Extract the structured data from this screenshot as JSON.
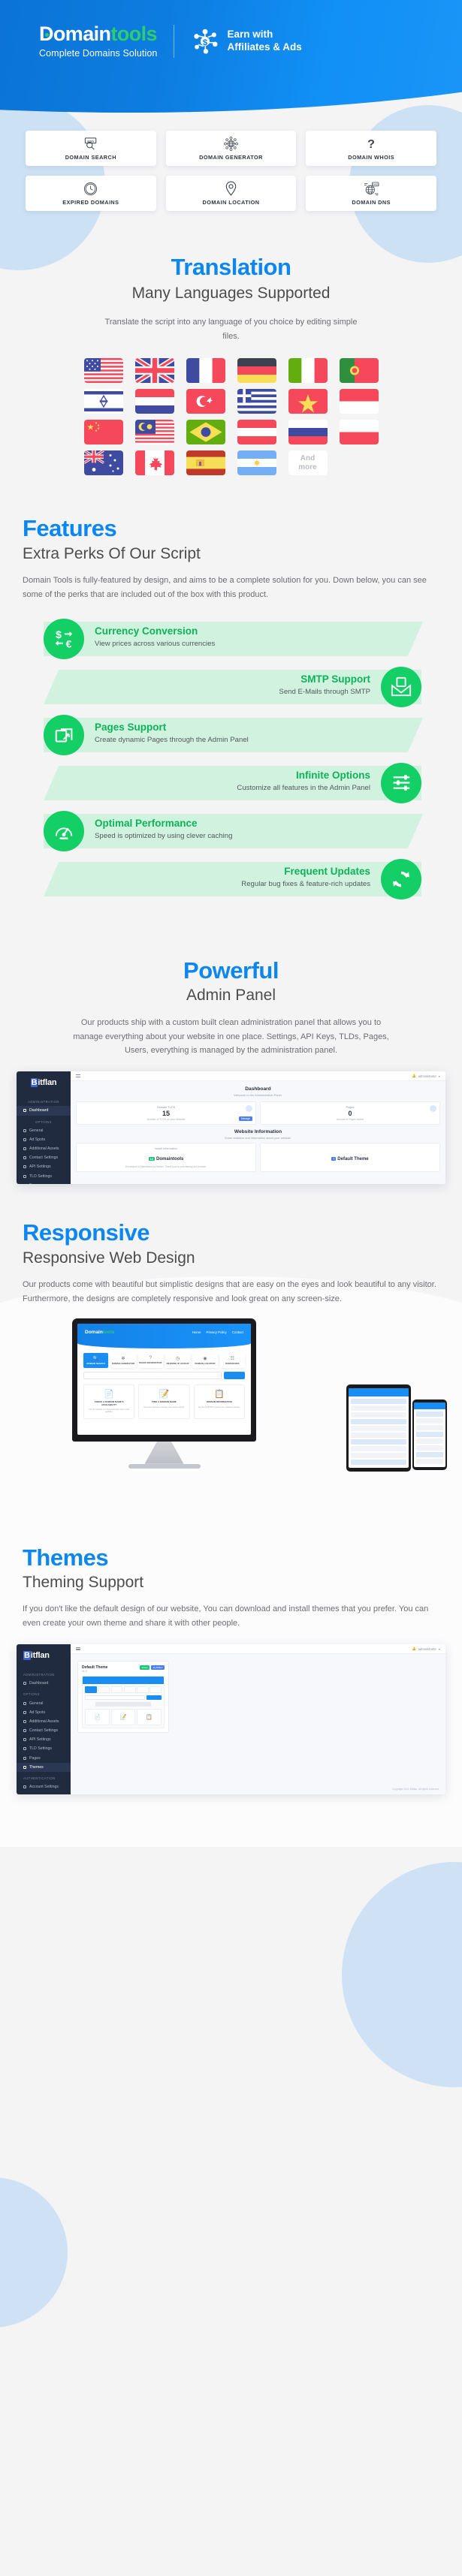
{
  "hero": {
    "brand_first": "D",
    "brand_main": "omain",
    "brand_accent": "tools",
    "tagline": "Complete Domains Solution",
    "earn_line1": "Earn with",
    "earn_line2": "Affiliates & Ads",
    "earn_icon": "network-money-icon",
    "bg_color": "#0d7ce0"
  },
  "tools": [
    {
      "label": "DOMAIN SEARCH",
      "icon": "www-magnifier-icon"
    },
    {
      "label": "DOMAIN GENERATOR",
      "icon": "globe-network-icon"
    },
    {
      "label": "DOMAIN WHOIS",
      "icon": "question-mark-icon"
    },
    {
      "label": "EXPIRED DOMAINS",
      "icon": "clock-icon"
    },
    {
      "label": "DOMAIN LOCATION",
      "icon": "map-pin-icon"
    },
    {
      "label": "DOMAIN DNS",
      "icon": "globe-dns-icon"
    }
  ],
  "translation": {
    "title": "Translation",
    "subtitle": "Many Languages Supported",
    "paragraph": "Translate the script into any language of you choice by editing simple files.",
    "and_more_line1": "And",
    "and_more_line2": "more",
    "flags": [
      {
        "name": "united-states"
      },
      {
        "name": "united-kingdom"
      },
      {
        "name": "france"
      },
      {
        "name": "germany"
      },
      {
        "name": "italy"
      },
      {
        "name": "portugal"
      },
      {
        "name": "israel"
      },
      {
        "name": "netherlands"
      },
      {
        "name": "turkey"
      },
      {
        "name": "greece"
      },
      {
        "name": "vietnam"
      },
      {
        "name": "indonesia"
      },
      {
        "name": "china"
      },
      {
        "name": "malaysia"
      },
      {
        "name": "brazil"
      },
      {
        "name": "austria"
      },
      {
        "name": "russia"
      },
      {
        "name": "poland"
      },
      {
        "name": "australia"
      },
      {
        "name": "canada"
      },
      {
        "name": "spain"
      },
      {
        "name": "argentina"
      }
    ]
  },
  "features": {
    "title": "Features",
    "subtitle": "Extra Perks Of Our Script",
    "paragraph": "Domain Tools is fully-featured by design, and aims to be a complete solution for you. Down below, you can see some of the perks that are included out of the box with this product.",
    "accent_color": "#14ce66",
    "items": [
      {
        "title": "Currency Conversion",
        "desc": "View prices across various currencies",
        "icon": "currency-exchange-icon",
        "side": "left"
      },
      {
        "title": "SMTP Support",
        "desc": "Send E-Mails through SMTP",
        "icon": "envelope-icon",
        "side": "right"
      },
      {
        "title": "Pages Support",
        "desc": "Create dynamic Pages through the Admin Panel",
        "icon": "pages-copy-icon",
        "side": "left"
      },
      {
        "title": "Infinite Options",
        "desc": "Customize all features in the Admin Panel",
        "icon": "sliders-icon",
        "side": "right"
      },
      {
        "title": "Optimal Performance",
        "desc": "Speed is optimized by using clever caching",
        "icon": "speedometer-icon",
        "side": "left"
      },
      {
        "title": "Frequent Updates",
        "desc": "Regular bug fixes & feature-rich updates",
        "icon": "refresh-cycle-icon",
        "side": "right"
      }
    ]
  },
  "admin": {
    "title": "Powerful",
    "subtitle": "Admin Panel",
    "paragraph": "Our products ship with a custom built clean administration panel that allows you to manage everything about your website in one place. Settings, API Keys, TLDs, Pages, Users, everything is managed by the administration panel.",
    "panel": {
      "logo_first": "B",
      "logo_rest": "itflan",
      "burger_icon": "hamburger-icon",
      "bell_icon": "bell-icon",
      "user_label": "administrator",
      "group_admin": "Administration",
      "group_options": "Options",
      "group_auth": "Authentication",
      "nav": [
        {
          "label": "Dashboard",
          "icon": "dashboard-icon",
          "active": true
        },
        {
          "label": "General",
          "icon": "globe-icon"
        },
        {
          "label": "Ad Spots",
          "icon": "ad-icon"
        },
        {
          "label": "Additional Assets",
          "icon": "code-icon"
        },
        {
          "label": "Contact Settings",
          "icon": "mail-icon"
        },
        {
          "label": "API Settings",
          "icon": "api-icon"
        },
        {
          "label": "TLD Settings",
          "icon": "tld-icon"
        },
        {
          "label": "Pages",
          "icon": "page-icon"
        },
        {
          "label": "Themes",
          "icon": "theme-icon"
        },
        {
          "label": "Account Settings",
          "icon": "user-icon"
        }
      ],
      "heading": "Dashboard",
      "subheading": "Welcome to the Administration Panel.",
      "stat1_label": "Domain TLDS",
      "stat1_value": "15",
      "stat1_sub": "Number of TLDS on your Website",
      "stat1_button": "Manage",
      "stat2_label": "Pages",
      "stat2_value": "0",
      "stat2_sub": "Amount of Pages added",
      "info_heading": "Website Information",
      "info_sub": "Some statistics and information about your website.",
      "install_label": "Install Information",
      "product_version": "1.0",
      "product_name": "Domaintools",
      "install_note": "Developed & Maintained by Bitflan. Thank you for purchasing our product.",
      "theme_label": "Default Theme"
    }
  },
  "responsive": {
    "title": "Responsive",
    "subtitle": "Responsive Web Design",
    "paragraph": "Our products come with beautiful but simplistic designs that are easy on the eyes and look beautiful to any visitor. Furthermore, the designs are completely responsive and look great on any screen-size.",
    "site": {
      "logo_main": "Domain",
      "logo_accent": "tools",
      "links": [
        "Home",
        "Privacy Policy",
        "Contact"
      ],
      "tools": [
        {
          "label": "DOMAIN SEARCH",
          "icon": "www-magnifier-icon",
          "active": true
        },
        {
          "label": "DOMAIN GENERATOR",
          "icon": "globe-network-icon"
        },
        {
          "label": "WHOIS INFORMATION",
          "icon": "question-mark-icon"
        },
        {
          "label": "REVERSE IP LOOKUP",
          "icon": "clock-icon"
        },
        {
          "label": "DOMAIN LOCATION",
          "icon": "map-pin-icon"
        },
        {
          "label": "DOMAIN DNS",
          "icon": "globe-dns-icon"
        }
      ],
      "search_placeholder": "example.com",
      "search_button": "SEARCH",
      "cards": [
        {
          "title": "CHECK A DOMAIN NAME'S AVAILABILITY",
          "desc": "Find out whether your desired domain name is still available."
        },
        {
          "title": "FIND A DOMAIN NAME",
          "desc": "Generate hundreds of domain name ideas instantly."
        },
        {
          "title": "DOMAIN INFORMATION",
          "desc": "See the full WHOIS record of any registered domain."
        }
      ]
    }
  },
  "themes": {
    "title": "Themes",
    "subtitle": "Theming Support",
    "paragraph": "If you don't like the default design of our website, You can download and install themes that you prefer. You can even create your own theme and share it with other people.",
    "card": {
      "name": "Default Theme",
      "version": "v1.0",
      "tag_active": "Active",
      "tag_author": "By Bitflan"
    },
    "footer_note": "Copyright 2021 Bitflan. All rights reserved."
  }
}
